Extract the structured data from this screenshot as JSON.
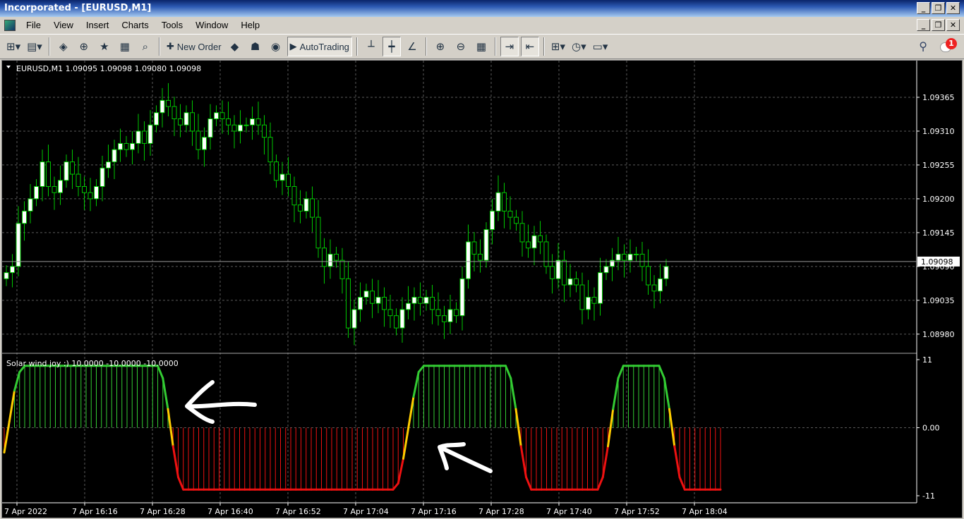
{
  "window": {
    "title": "Incorporated - [EURUSD,M1]",
    "min": "_",
    "restore": "❐",
    "close": "✕"
  },
  "menu": [
    "File",
    "View",
    "Insert",
    "Charts",
    "Tools",
    "Window",
    "Help"
  ],
  "toolbar": {
    "new_order": "New Order",
    "autotrading": "AutoTrading"
  },
  "notifications": {
    "count": "1"
  },
  "chart": {
    "symbol_header": "EURUSD,M1  1.09095 1.09098 1.09080 1.09098",
    "current_price": "1.09098",
    "price_ticks": [
      "1.09365",
      "1.09310",
      "1.09255",
      "1.09200",
      "1.09145",
      "1.09090",
      "1.09035",
      "1.08980"
    ],
    "time_ticks": [
      "7 Apr 2022",
      "7 Apr 16:16",
      "7 Apr 16:28",
      "7 Apr 16:40",
      "7 Apr 16:52",
      "7 Apr 17:04",
      "7 Apr 17:16",
      "7 Apr 17:28",
      "7 Apr 17:40",
      "7 Apr 17:52",
      "7 Apr 18:04"
    ],
    "indicator_header": "Solar wind joy :)  10.0000 -10.0000 -10.0000",
    "indicator_ticks": [
      "11",
      "0.00",
      "-11"
    ],
    "colors": {
      "bg": "#000000",
      "grid": "#5a5a5a",
      "bull": "#ffffff",
      "bear": "#000000",
      "candle_border": "#00c800",
      "green": "#33cc33",
      "red": "#ee1111",
      "yellow": "#ffcc00",
      "axis": "#ffffff"
    }
  },
  "chart_data": {
    "type": "candlestick",
    "timeframe": "M1",
    "symbol": "EURUSD",
    "ylim": [
      1.0895,
      1.0942
    ],
    "close": [
      1.0908,
      1.0909,
      1.0916,
      1.0918,
      1.092,
      1.0922,
      1.0926,
      1.0922,
      1.0921,
      1.0923,
      1.0926,
      1.0924,
      1.0922,
      1.0921,
      1.092,
      1.0922,
      1.0925,
      1.0926,
      1.0928,
      1.0929,
      1.0928,
      1.0929,
      1.0931,
      1.0929,
      1.0932,
      1.0934,
      1.0936,
      1.0935,
      1.0933,
      1.0932,
      1.0934,
      1.0931,
      1.0928,
      1.093,
      1.0933,
      1.0934,
      1.0933,
      1.0932,
      1.0931,
      1.0932,
      1.0932,
      1.0933,
      1.0932,
      1.093,
      1.0926,
      1.0923,
      1.0924,
      1.0922,
      1.0919,
      1.0918,
      1.092,
      1.0917,
      1.0912,
      1.0909,
      1.0911,
      1.091,
      1.0907,
      1.0899,
      1.0902,
      1.0904,
      1.0905,
      1.0903,
      1.0904,
      1.0902,
      1.0901,
      1.0899,
      1.0902,
      1.0903,
      1.0904,
      1.0903,
      1.0904,
      1.0902,
      1.0901,
      1.09,
      1.0902,
      1.0901,
      1.0907,
      1.0913,
      1.0911,
      1.091,
      1.0915,
      1.0918,
      1.0921,
      1.0918,
      1.0917,
      1.0916,
      1.0913,
      1.0912,
      1.0914,
      1.0913,
      1.0909,
      1.0907,
      1.091,
      1.0906,
      1.0907,
      1.0906,
      1.0902,
      1.0904,
      1.0903,
      1.0908,
      1.0909,
      1.091,
      1.0911,
      1.091,
      1.0911,
      1.0911,
      1.0909,
      1.0906,
      1.0905,
      1.0907,
      1.0909
    ],
    "indicator": {
      "name": "Solar wind joy :)",
      "range": [
        -11,
        11
      ],
      "values": [
        -4,
        1,
        6,
        9,
        10,
        10,
        10,
        10,
        10,
        10,
        10,
        10,
        10,
        10,
        10,
        10,
        10,
        10,
        10,
        10,
        10,
        10,
        10,
        10,
        10,
        10,
        10,
        10,
        10,
        10,
        10,
        8,
        3,
        -3,
        -8,
        -10,
        -10,
        -10,
        -10,
        -10,
        -10,
        -10,
        -10,
        -10,
        -10,
        -10,
        -10,
        -10,
        -10,
        -10,
        -10,
        -10,
        -10,
        -10,
        -10,
        -10,
        -10,
        -10,
        -10,
        -10,
        -10,
        -10,
        -10,
        -10,
        -10,
        -10,
        -10,
        -10,
        -10,
        -10,
        -10,
        -10,
        -10,
        -10,
        -10,
        -10,
        -10,
        -9,
        -5,
        0,
        5,
        9,
        10,
        10,
        10,
        10,
        10,
        10,
        10,
        10,
        10,
        10,
        10,
        10,
        10,
        10,
        10,
        10,
        10,
        8,
        3,
        -3,
        -8,
        -10,
        -10,
        -10,
        -10,
        -10,
        -10,
        -10,
        -10,
        -10,
        -10,
        -10,
        -10,
        -10,
        -10,
        -8,
        -3,
        3,
        8,
        10,
        10,
        10,
        10,
        10,
        10,
        10,
        10,
        8,
        3,
        -3,
        -8,
        -10,
        -10,
        -10,
        -10,
        -10,
        -10,
        -10,
        -10
      ]
    }
  }
}
